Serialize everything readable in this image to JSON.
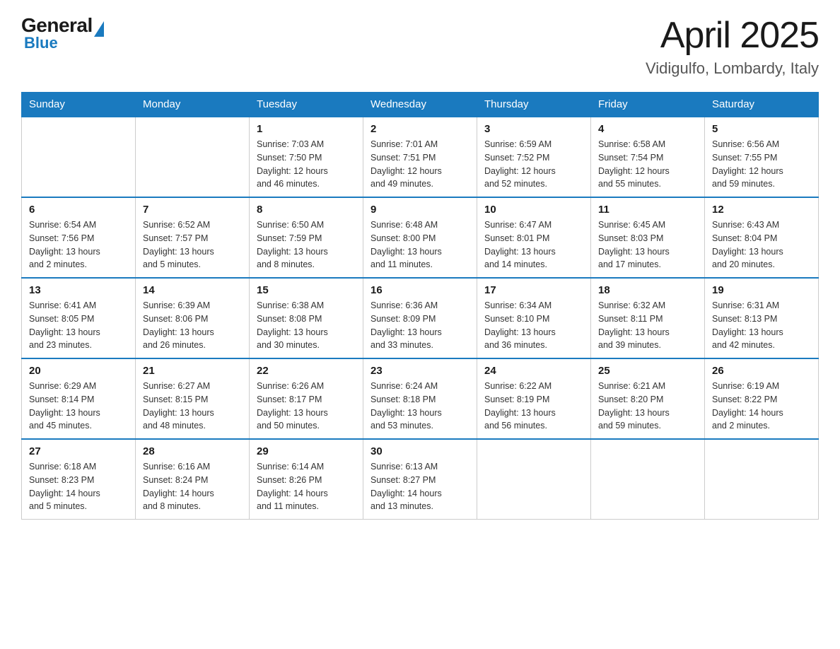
{
  "logo": {
    "general": "General",
    "blue": "Blue"
  },
  "title": "April 2025",
  "subtitle": "Vidigulfo, Lombardy, Italy",
  "weekdays": [
    "Sunday",
    "Monday",
    "Tuesday",
    "Wednesday",
    "Thursday",
    "Friday",
    "Saturday"
  ],
  "weeks": [
    [
      {
        "day": "",
        "info": ""
      },
      {
        "day": "",
        "info": ""
      },
      {
        "day": "1",
        "info": "Sunrise: 7:03 AM\nSunset: 7:50 PM\nDaylight: 12 hours\nand 46 minutes."
      },
      {
        "day": "2",
        "info": "Sunrise: 7:01 AM\nSunset: 7:51 PM\nDaylight: 12 hours\nand 49 minutes."
      },
      {
        "day": "3",
        "info": "Sunrise: 6:59 AM\nSunset: 7:52 PM\nDaylight: 12 hours\nand 52 minutes."
      },
      {
        "day": "4",
        "info": "Sunrise: 6:58 AM\nSunset: 7:54 PM\nDaylight: 12 hours\nand 55 minutes."
      },
      {
        "day": "5",
        "info": "Sunrise: 6:56 AM\nSunset: 7:55 PM\nDaylight: 12 hours\nand 59 minutes."
      }
    ],
    [
      {
        "day": "6",
        "info": "Sunrise: 6:54 AM\nSunset: 7:56 PM\nDaylight: 13 hours\nand 2 minutes."
      },
      {
        "day": "7",
        "info": "Sunrise: 6:52 AM\nSunset: 7:57 PM\nDaylight: 13 hours\nand 5 minutes."
      },
      {
        "day": "8",
        "info": "Sunrise: 6:50 AM\nSunset: 7:59 PM\nDaylight: 13 hours\nand 8 minutes."
      },
      {
        "day": "9",
        "info": "Sunrise: 6:48 AM\nSunset: 8:00 PM\nDaylight: 13 hours\nand 11 minutes."
      },
      {
        "day": "10",
        "info": "Sunrise: 6:47 AM\nSunset: 8:01 PM\nDaylight: 13 hours\nand 14 minutes."
      },
      {
        "day": "11",
        "info": "Sunrise: 6:45 AM\nSunset: 8:03 PM\nDaylight: 13 hours\nand 17 minutes."
      },
      {
        "day": "12",
        "info": "Sunrise: 6:43 AM\nSunset: 8:04 PM\nDaylight: 13 hours\nand 20 minutes."
      }
    ],
    [
      {
        "day": "13",
        "info": "Sunrise: 6:41 AM\nSunset: 8:05 PM\nDaylight: 13 hours\nand 23 minutes."
      },
      {
        "day": "14",
        "info": "Sunrise: 6:39 AM\nSunset: 8:06 PM\nDaylight: 13 hours\nand 26 minutes."
      },
      {
        "day": "15",
        "info": "Sunrise: 6:38 AM\nSunset: 8:08 PM\nDaylight: 13 hours\nand 30 minutes."
      },
      {
        "day": "16",
        "info": "Sunrise: 6:36 AM\nSunset: 8:09 PM\nDaylight: 13 hours\nand 33 minutes."
      },
      {
        "day": "17",
        "info": "Sunrise: 6:34 AM\nSunset: 8:10 PM\nDaylight: 13 hours\nand 36 minutes."
      },
      {
        "day": "18",
        "info": "Sunrise: 6:32 AM\nSunset: 8:11 PM\nDaylight: 13 hours\nand 39 minutes."
      },
      {
        "day": "19",
        "info": "Sunrise: 6:31 AM\nSunset: 8:13 PM\nDaylight: 13 hours\nand 42 minutes."
      }
    ],
    [
      {
        "day": "20",
        "info": "Sunrise: 6:29 AM\nSunset: 8:14 PM\nDaylight: 13 hours\nand 45 minutes."
      },
      {
        "day": "21",
        "info": "Sunrise: 6:27 AM\nSunset: 8:15 PM\nDaylight: 13 hours\nand 48 minutes."
      },
      {
        "day": "22",
        "info": "Sunrise: 6:26 AM\nSunset: 8:17 PM\nDaylight: 13 hours\nand 50 minutes."
      },
      {
        "day": "23",
        "info": "Sunrise: 6:24 AM\nSunset: 8:18 PM\nDaylight: 13 hours\nand 53 minutes."
      },
      {
        "day": "24",
        "info": "Sunrise: 6:22 AM\nSunset: 8:19 PM\nDaylight: 13 hours\nand 56 minutes."
      },
      {
        "day": "25",
        "info": "Sunrise: 6:21 AM\nSunset: 8:20 PM\nDaylight: 13 hours\nand 59 minutes."
      },
      {
        "day": "26",
        "info": "Sunrise: 6:19 AM\nSunset: 8:22 PM\nDaylight: 14 hours\nand 2 minutes."
      }
    ],
    [
      {
        "day": "27",
        "info": "Sunrise: 6:18 AM\nSunset: 8:23 PM\nDaylight: 14 hours\nand 5 minutes."
      },
      {
        "day": "28",
        "info": "Sunrise: 6:16 AM\nSunset: 8:24 PM\nDaylight: 14 hours\nand 8 minutes."
      },
      {
        "day": "29",
        "info": "Sunrise: 6:14 AM\nSunset: 8:26 PM\nDaylight: 14 hours\nand 11 minutes."
      },
      {
        "day": "30",
        "info": "Sunrise: 6:13 AM\nSunset: 8:27 PM\nDaylight: 14 hours\nand 13 minutes."
      },
      {
        "day": "",
        "info": ""
      },
      {
        "day": "",
        "info": ""
      },
      {
        "day": "",
        "info": ""
      }
    ]
  ]
}
